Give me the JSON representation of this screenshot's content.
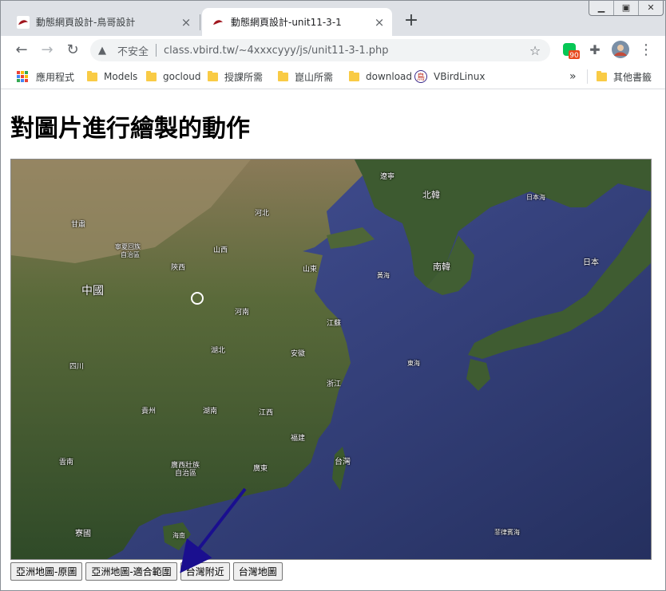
{
  "browser": {
    "tabs": [
      {
        "title": "動態網頁設計-鳥哥設計",
        "active": false
      },
      {
        "title": "動態網頁設計-unit11-3-1",
        "active": true
      }
    ],
    "new_tab_icon": "plus-icon",
    "address": {
      "security_label": "不安全",
      "url": "class.vbird.tw/~4xxxcyyy/js/unit11-3-1.php"
    },
    "extension_badge": "90",
    "bookmarks": [
      {
        "label": "應用程式",
        "icon": "apps-icon"
      },
      {
        "label": "Models",
        "icon": "folder-icon"
      },
      {
        "label": "gocloud",
        "icon": "folder-icon"
      },
      {
        "label": "授課所需",
        "icon": "folder-icon"
      },
      {
        "label": "崑山所需",
        "icon": "folder-icon"
      },
      {
        "label": "download",
        "icon": "folder-icon"
      },
      {
        "label": "VBirdLinux",
        "icon": "vbird-icon"
      }
    ],
    "other_bookmarks": "其他書籤",
    "overflow": "»"
  },
  "page": {
    "heading": "對圖片進行繪製的動作",
    "map_labels": [
      {
        "text": "遼寧"
      },
      {
        "text": "北韓"
      },
      {
        "text": "日本海"
      },
      {
        "text": "日本"
      },
      {
        "text": "南韓"
      },
      {
        "text": "黃海"
      },
      {
        "text": "甘肅"
      },
      {
        "text": "寧夏回族"
      },
      {
        "text": "自治區"
      },
      {
        "text": "陝西"
      },
      {
        "text": "山西"
      },
      {
        "text": "河北"
      },
      {
        "text": "山東"
      },
      {
        "text": "中國"
      },
      {
        "text": "河南"
      },
      {
        "text": "江蘇"
      },
      {
        "text": "安徽"
      },
      {
        "text": "湖北"
      },
      {
        "text": "四川"
      },
      {
        "text": "東海"
      },
      {
        "text": "浙江"
      },
      {
        "text": "貴州"
      },
      {
        "text": "湖南"
      },
      {
        "text": "江西"
      },
      {
        "text": "福建"
      },
      {
        "text": "台灣"
      },
      {
        "text": "雲南"
      },
      {
        "text": "廣西壯族"
      },
      {
        "text": "自治區"
      },
      {
        "text": "廣東"
      },
      {
        "text": "寮國"
      },
      {
        "text": "海南"
      },
      {
        "text": "菲律賓海"
      }
    ],
    "buttons": [
      {
        "label": "亞洲地圖-原圖"
      },
      {
        "label": "亞洲地圖-適合範圍"
      },
      {
        "label": "台灣附近"
      },
      {
        "label": "台灣地圖"
      }
    ]
  },
  "colors": {
    "tab_strip": "#dee1e6",
    "accent_arrow": "#1a0f8f",
    "sea": "#3c4a8f",
    "land": "#3f5a30"
  }
}
